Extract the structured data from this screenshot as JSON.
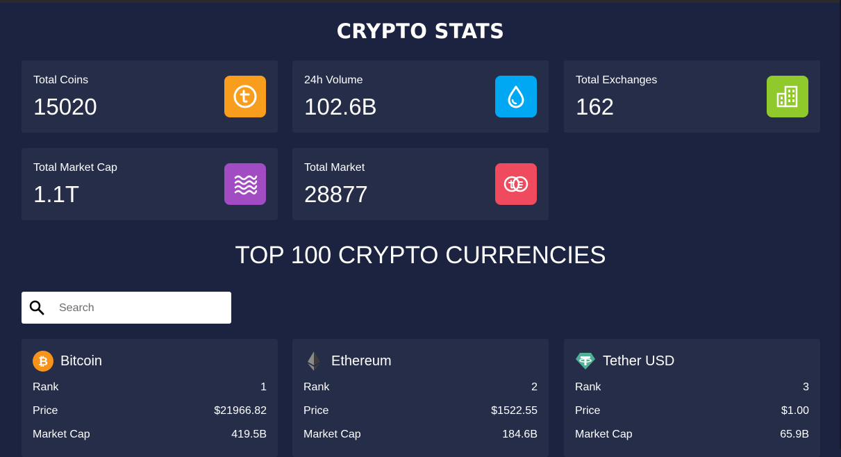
{
  "page": {
    "title": "CRYPTO STATS",
    "subtitle": "TOP 100 CRYPTO CURRENCIES"
  },
  "stats": [
    {
      "label": "Total Coins",
      "value": "15020",
      "icon": "coin-t-icon",
      "color": "#f89d1c"
    },
    {
      "label": "24h Volume",
      "value": "102.6B",
      "icon": "droplet-icon",
      "color": "#00a8f3"
    },
    {
      "label": "Total Exchanges",
      "value": "162",
      "icon": "building-icon",
      "color": "#8fc92c"
    },
    {
      "label": "Total Market Cap",
      "value": "1.1T",
      "icon": "waves-icon",
      "color": "#a24cc4"
    },
    {
      "label": "Total Market",
      "value": "28877",
      "icon": "coins-exchange-icon",
      "color": "#ef4a5d"
    }
  ],
  "search": {
    "placeholder": "Search",
    "value": ""
  },
  "coins": [
    {
      "name": "Bitcoin",
      "icon": "bitcoin-icon",
      "rank_label": "Rank",
      "rank": "1",
      "price_label": "Price",
      "price": "$21966.82",
      "cap_label": "Market Cap",
      "cap": "419.5B"
    },
    {
      "name": "Ethereum",
      "icon": "ethereum-icon",
      "rank_label": "Rank",
      "rank": "2",
      "price_label": "Price",
      "price": "$1522.55",
      "cap_label": "Market Cap",
      "cap": "184.6B"
    },
    {
      "name": "Tether USD",
      "icon": "tether-icon",
      "rank_label": "Rank",
      "rank": "3",
      "price_label": "Price",
      "price": "$1.00",
      "cap_label": "Market Cap",
      "cap": "65.9B"
    }
  ]
}
